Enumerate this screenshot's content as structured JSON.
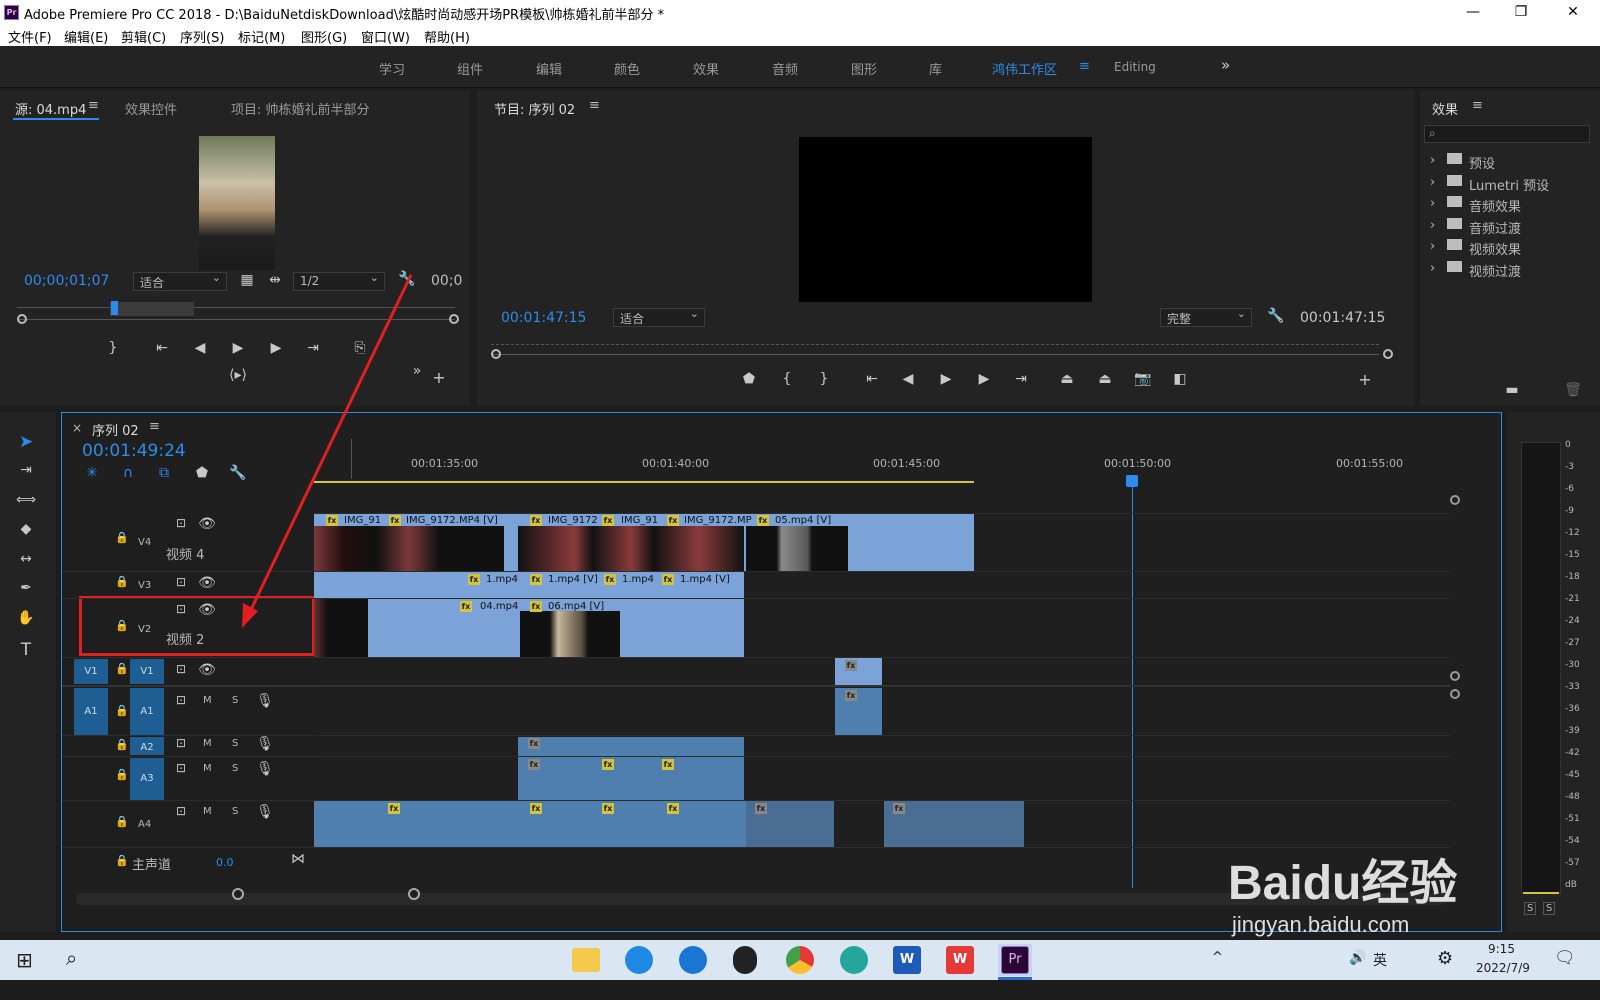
{
  "window": {
    "title": "Adobe Premiere Pro CC 2018 - D:\\BaiduNetdiskDownload\\炫酷时尚动感开场PR模板\\帅栋婚礼前半部分 *",
    "app_icon": "Pr",
    "minimize": "—",
    "maximize": "❐",
    "close": "✕"
  },
  "menu": [
    "文件(F)",
    "编辑(E)",
    "剪辑(C)",
    "序列(S)",
    "标记(M)",
    "图形(G)",
    "窗口(W)",
    "帮助(H)"
  ],
  "workspaces": {
    "items": [
      "学习",
      "组件",
      "编辑",
      "颜色",
      "效果",
      "音频",
      "图形",
      "库"
    ],
    "active": "鸿伟工作区",
    "extra": "Editing",
    "more": "»"
  },
  "source_panel": {
    "tabs": [
      "源: 04.mp4",
      "效果控件",
      "项目: 帅栋婚礼前半部分"
    ],
    "timecode": "00;00;01;07",
    "fit": "适合",
    "resolution": "1/2",
    "timecode_right": "00;0"
  },
  "program_panel": {
    "title": "节目: 序列 02",
    "timecode": "00:01:47:15",
    "fit": "适合",
    "quality": "完整",
    "duration": "00:01:47:15"
  },
  "effects_panel": {
    "title": "效果",
    "search_placeholder": "",
    "items": [
      "预设",
      "Lumetri 预设",
      "音频效果",
      "音频过渡",
      "视频效果",
      "视频过渡"
    ]
  },
  "timeline": {
    "close": "×",
    "title": "序列 02",
    "timecode": "00:01:49:24",
    "ruler": [
      "00:01:35:00",
      "00:01:40:00",
      "00:01:45:00",
      "00:01:50:00",
      "00:01:55:00"
    ],
    "tracks": {
      "v4": "V4",
      "v4_name": "视频 4",
      "v3": "V3",
      "v2": "V2",
      "v2_name": "视频 2",
      "v1": "V1",
      "a1": "A1",
      "a2": "A2",
      "a3": "A3",
      "a4": "A4",
      "master": "主声道",
      "master_val": "0.0",
      "m": "M",
      "s": "S"
    },
    "clips": {
      "v4": [
        "IMG_91",
        "IMG_9172.MP4 [V]",
        "IMG_9172",
        "IMG_91",
        "IMG_9172.MP",
        "05.mp4 [V]"
      ],
      "v3": [
        "1.mp4",
        "1.mp4 [V]",
        "1.mp4",
        "1.mp4 [V]"
      ],
      "v2": [
        "04.mp4",
        "06.mp4 [V]"
      ],
      "fx": "fx"
    }
  },
  "meter": {
    "labels": [
      "0",
      "-3",
      "-6",
      "-9",
      "-12",
      "-15",
      "-18",
      "-21",
      "-24",
      "-27",
      "-30",
      "-33",
      "-36",
      "-39",
      "-42",
      "-45",
      "-48",
      "-51",
      "-54",
      "-57",
      "dB"
    ],
    "solo": "S"
  },
  "watermark": {
    "brand": "Baidu经验",
    "url": "jingyan.baidu.com"
  },
  "taskbar": {
    "time": "9:15",
    "date": "2022/7/9",
    "ime": "英"
  }
}
